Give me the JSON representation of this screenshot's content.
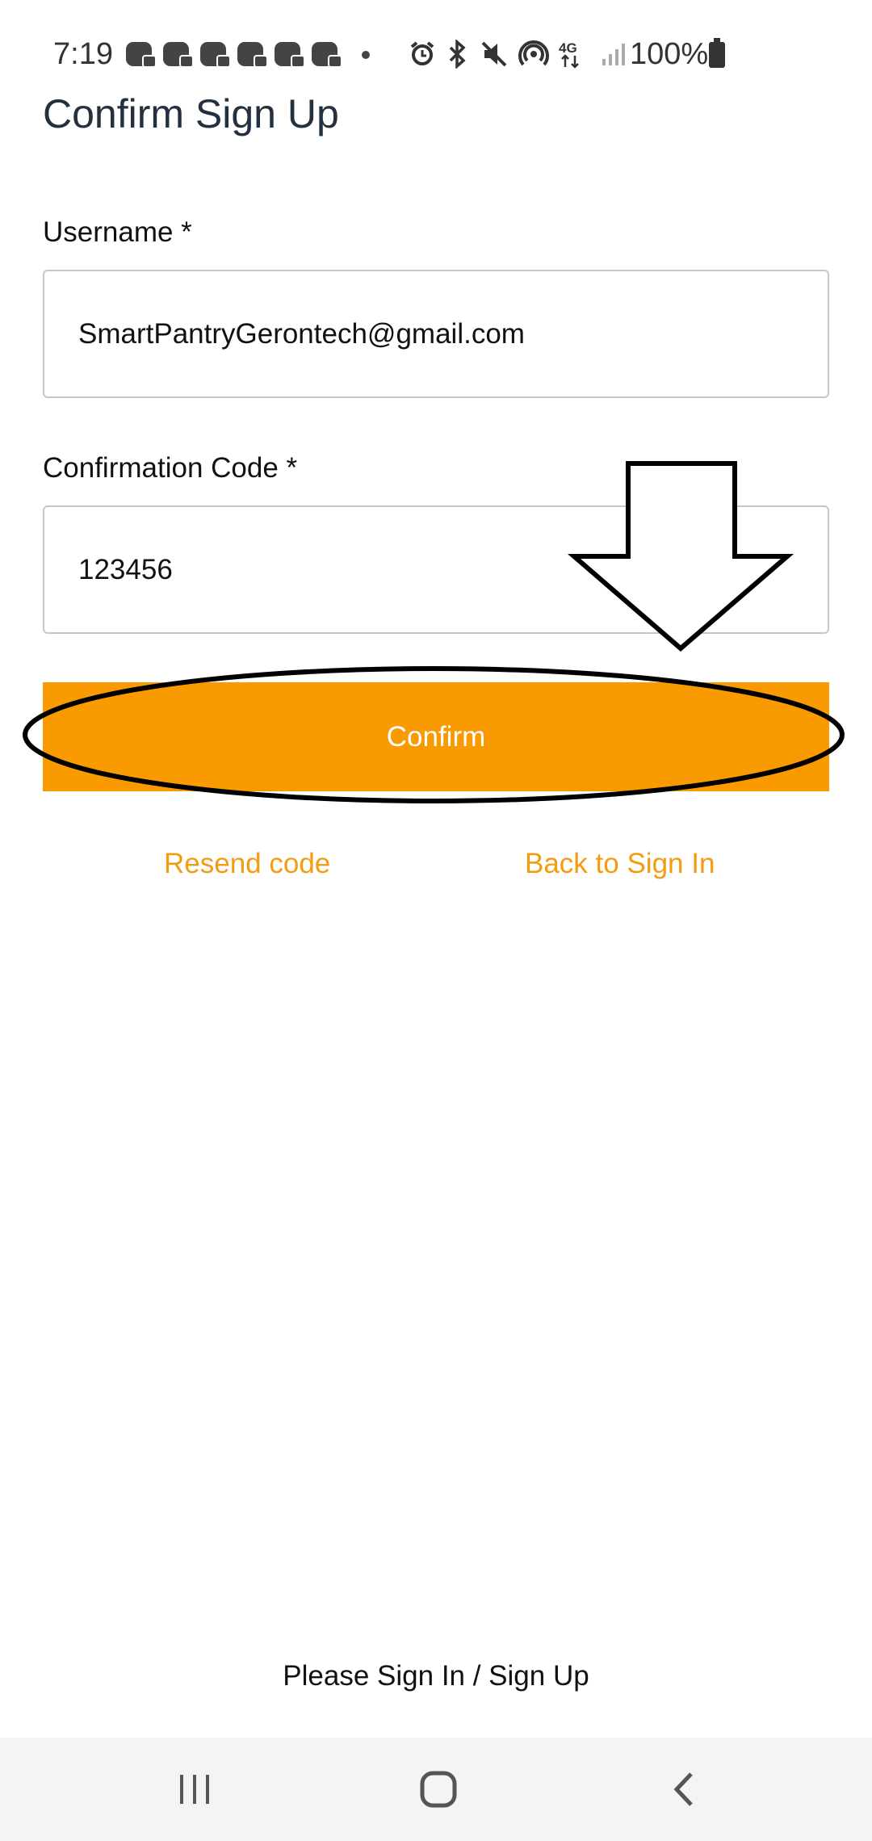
{
  "status_bar": {
    "time": "7:19",
    "battery_text": "100%",
    "notification_icons": [
      "discord-icon",
      "discord-icon",
      "discord-icon",
      "discord-icon",
      "discord-icon",
      "discord-icon"
    ],
    "system_icons": [
      "alarm-icon",
      "bluetooth-icon",
      "mute-icon",
      "hotspot-icon",
      "4g-icon",
      "signal-icon",
      "battery-icon"
    ]
  },
  "title": "Confirm Sign Up",
  "username": {
    "label": "Username *",
    "value": "SmartPantryGerontech@gmail.com"
  },
  "code": {
    "label": "Confirmation Code *",
    "value": "123456"
  },
  "confirm_button": "Confirm",
  "links": {
    "resend": "Resend code",
    "back": "Back to Sign In"
  },
  "footer": "Please Sign In / Sign Up",
  "colors": {
    "accent": "#f89a00",
    "link": "#f39c12",
    "title": "#22303f"
  },
  "nav_icons": [
    "recent-apps-icon",
    "home-icon",
    "back-icon"
  ]
}
